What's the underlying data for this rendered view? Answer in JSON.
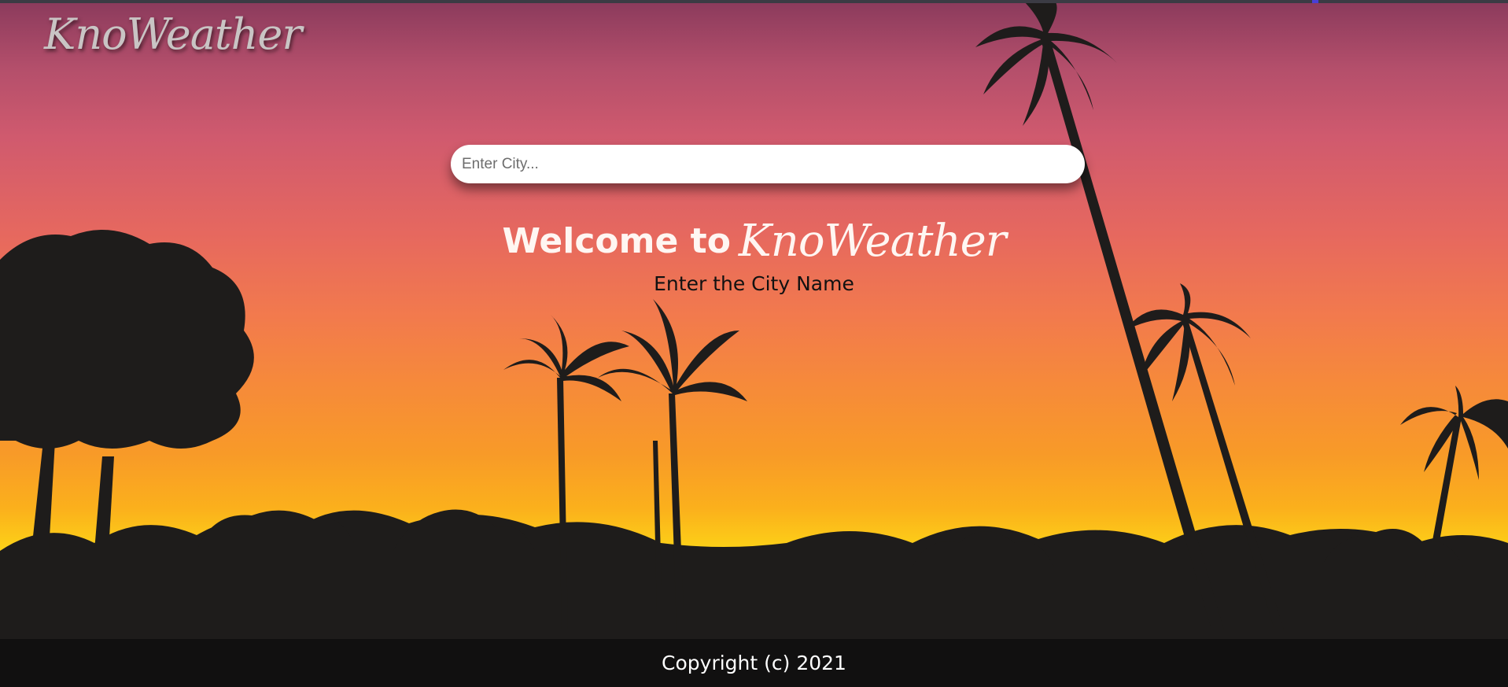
{
  "header": {
    "brand": "KnoWeather"
  },
  "search": {
    "placeholder": "Enter City...",
    "value": ""
  },
  "hero": {
    "welcome_prefix": "Welcome to",
    "welcome_brand": "KnoWeather",
    "subtitle": "Enter the City Name"
  },
  "footer": {
    "copyright": "Copyright (c) 2021"
  },
  "colors": {
    "sky_top": "#8a3a5c",
    "sky_mid": "#f27a4d",
    "sky_bottom": "#fcd117",
    "silhouette": "#1e1c1b",
    "footer_bg": "#101010"
  }
}
